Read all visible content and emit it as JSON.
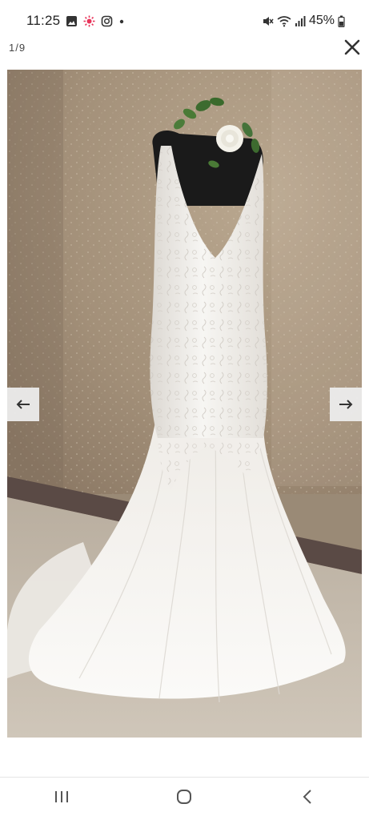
{
  "status_bar": {
    "time": "11:25",
    "battery": "45%",
    "icons": [
      "gallery-icon",
      "flower-icon",
      "instagram-icon",
      "dot-icon",
      "mute-icon",
      "wifi-icon",
      "signal-icon",
      "battery-icon"
    ]
  },
  "viewer": {
    "counter": "1/9",
    "close_icon": "close-icon",
    "prev_icon": "arrow-left-icon",
    "next_icon": "arrow-right-icon",
    "image_subject": "wedding-dress-photo"
  },
  "nav_bar": {
    "icons": [
      "recent-apps-icon",
      "home-icon",
      "back-icon"
    ]
  },
  "colors": {
    "wall": "#a39079",
    "carpet": "#c7bdaf",
    "baseboard": "#5a4a45",
    "dress": "#f4f2ee",
    "mannequin": "#1a1a1a",
    "arrow_button_bg": "#ececec"
  }
}
